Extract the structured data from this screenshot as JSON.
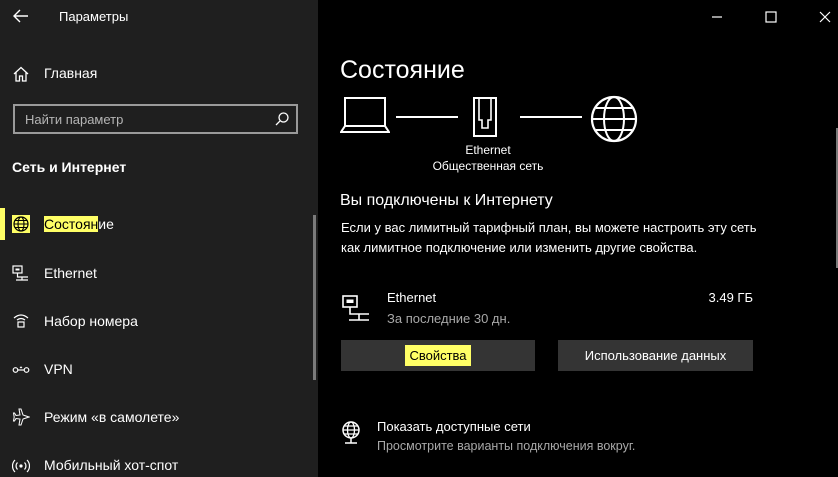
{
  "window": {
    "title": "Параметры"
  },
  "sidebar": {
    "home_label": "Главная",
    "search_placeholder": "Найти параметр",
    "section_title": "Сеть и Интернет",
    "items": [
      {
        "label_highlight": "Состоян",
        "label_rest": "ие",
        "icon": "globe-network-icon",
        "selected": true
      },
      {
        "label": "Ethernet",
        "icon": "ethernet-icon"
      },
      {
        "label": "Набор номера",
        "icon": "dialup-icon"
      },
      {
        "label": "VPN",
        "icon": "vpn-icon"
      },
      {
        "label": "Режим «в самолете»",
        "icon": "airplane-icon"
      },
      {
        "label": "Мобильный хот-спот",
        "icon": "hotspot-icon"
      }
    ]
  },
  "main": {
    "title": "Состояние",
    "diagram": {
      "adapter_name": "Ethernet",
      "network_type": "Общественная сеть"
    },
    "connected_title": "Вы подключены к Интернету",
    "description": "Если у вас лимитный тарифный план, вы можете настроить эту сеть как лимитное подключение или изменить другие свойства.",
    "connection": {
      "name": "Ethernet",
      "period": "За последние 30 дн.",
      "usage": "3.49 ГБ"
    },
    "buttons": {
      "properties": "Свойства",
      "data_usage": "Использование данных"
    },
    "show_networks": {
      "title": "Показать доступные сети",
      "subtitle": "Просмотрите варианты подключения вокруг."
    }
  },
  "colors": {
    "sidebar_bg": "#1f1f1f",
    "main_bg": "#000000",
    "highlight": "#ffff66",
    "button_bg": "#343434",
    "secondary_text": "#a8a8a8"
  }
}
